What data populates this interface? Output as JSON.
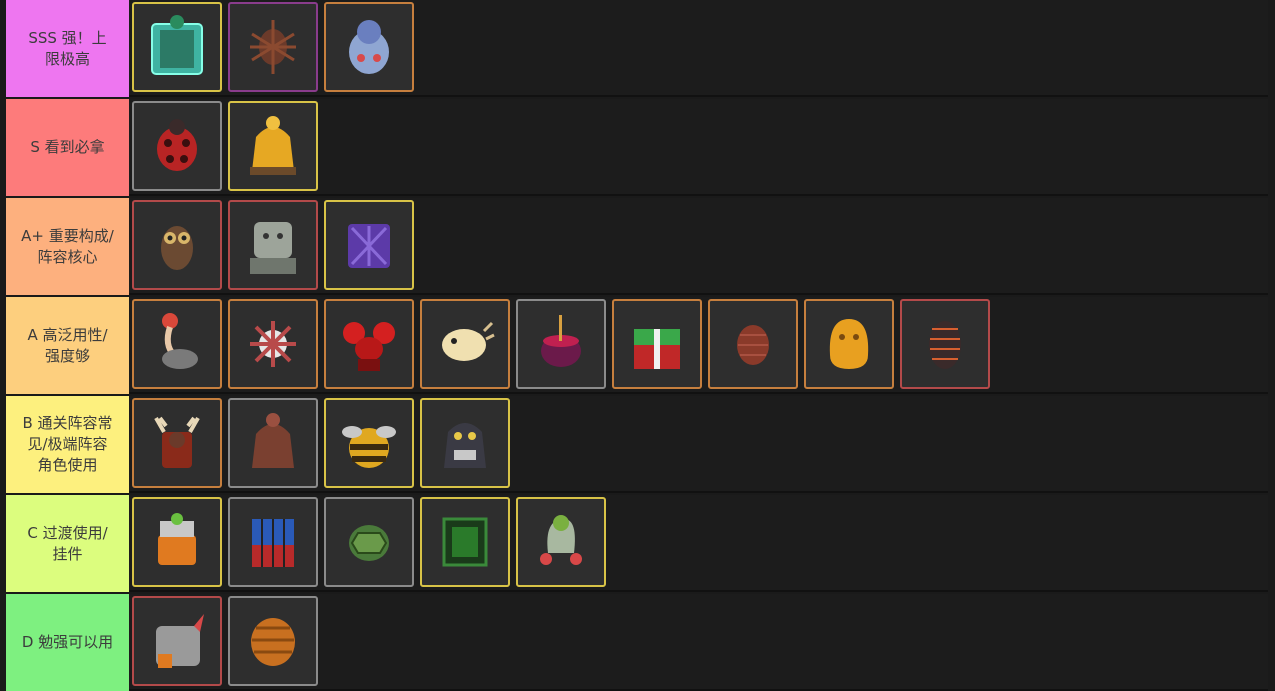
{
  "tiers": [
    {
      "label": "SSS 强！上\n限极高",
      "color": "#ee76f0",
      "items": [
        {
          "icon": "cactus-pot-icon",
          "rarity": "gold"
        },
        {
          "icon": "spiny-beetle-icon",
          "rarity": "purple"
        },
        {
          "icon": "blue-penguin-icon",
          "rarity": "orange"
        }
      ]
    },
    {
      "label": "S 看到必拿",
      "color": "#fd7b7b",
      "items": [
        {
          "icon": "ladybug-icon",
          "rarity": "grey"
        },
        {
          "icon": "golden-chicken-icon",
          "rarity": "gold"
        }
      ]
    },
    {
      "label": "A+ 重要构成/\n阵容核心",
      "color": "#fdb07e",
      "items": [
        {
          "icon": "owl-icon",
          "rarity": "red"
        },
        {
          "icon": "stone-lion-icon",
          "rarity": "red"
        },
        {
          "icon": "purple-hedgehog-icon",
          "rarity": "gold"
        }
      ]
    },
    {
      "label": "A 高泛用性/\n强度够",
      "color": "#fdcf7e",
      "items": [
        {
          "icon": "ostrich-icon",
          "rarity": "orange"
        },
        {
          "icon": "spiky-urchin-icon",
          "rarity": "orange"
        },
        {
          "icon": "red-crab-icon",
          "rarity": "orange"
        },
        {
          "icon": "pufferfish-icon",
          "rarity": "orange"
        },
        {
          "icon": "red-cauldron-icon",
          "rarity": "grey"
        },
        {
          "icon": "gift-box-icon",
          "rarity": "orange"
        },
        {
          "icon": "pinecone-icon",
          "rarity": "orange"
        },
        {
          "icon": "orange-blob-icon",
          "rarity": "orange"
        },
        {
          "icon": "trilobite-icon",
          "rarity": "red"
        }
      ]
    },
    {
      "label": "B 通关阵容常\n见/极端阵容\n角色使用",
      "color": "#fdf07e",
      "items": [
        {
          "icon": "moose-icon",
          "rarity": "orange"
        },
        {
          "icon": "brown-chicken-icon",
          "rarity": "grey"
        },
        {
          "icon": "bee-icon",
          "rarity": "gold"
        },
        {
          "icon": "gorilla-icon",
          "rarity": "gold"
        }
      ]
    },
    {
      "label": "C 过渡使用/\n挂件",
      "color": "#dcfd7e",
      "items": [
        {
          "icon": "robot-frog-icon",
          "rarity": "gold"
        },
        {
          "icon": "blue-dynamite-icon",
          "rarity": "grey"
        },
        {
          "icon": "turtle-shell-icon",
          "rarity": "grey"
        },
        {
          "icon": "green-cage-icon",
          "rarity": "gold"
        },
        {
          "icon": "hermit-crab-icon",
          "rarity": "gold"
        }
      ]
    },
    {
      "label": "D 勉强可以用",
      "color": "#7ef080",
      "items": [
        {
          "icon": "rhino-icon",
          "rarity": "red"
        },
        {
          "icon": "orange-armadillo-icon",
          "rarity": "grey"
        }
      ]
    }
  ]
}
